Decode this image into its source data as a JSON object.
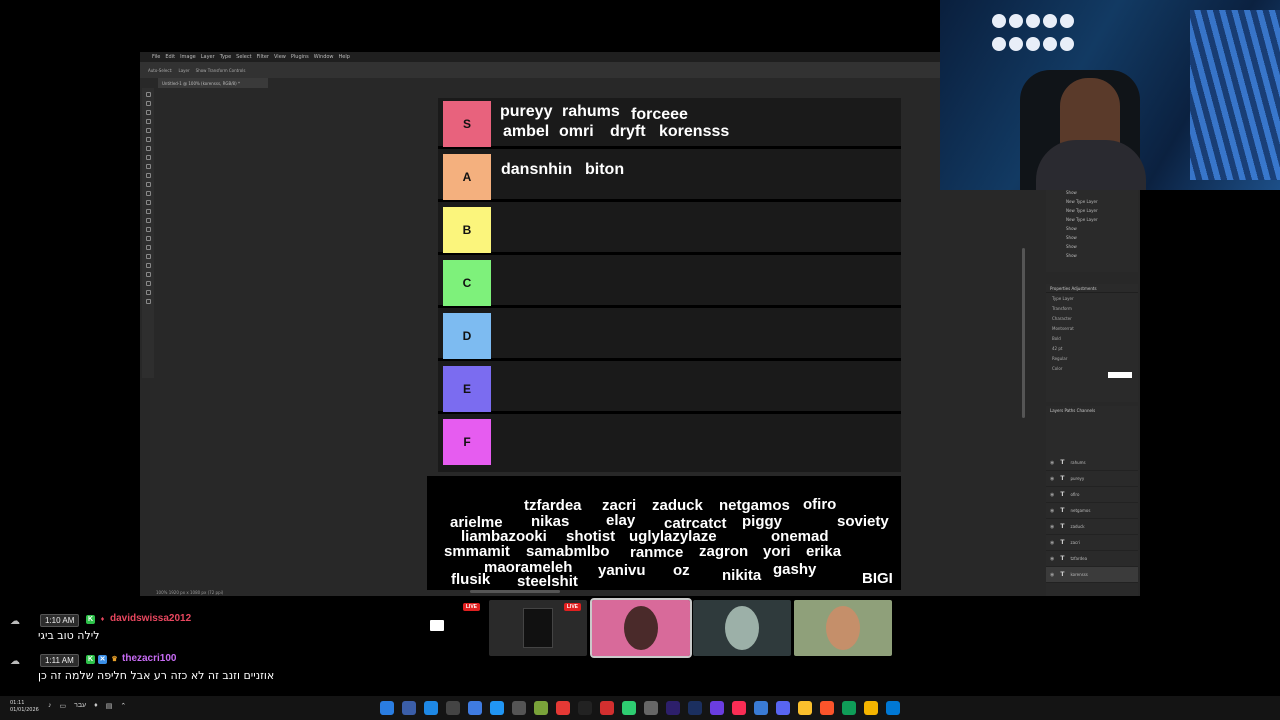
{
  "photoshop": {
    "menu": [
      "File",
      "Edit",
      "Image",
      "Layer",
      "Type",
      "Select",
      "Filter",
      "View",
      "Plugins",
      "Window",
      "Help"
    ],
    "options": [
      "Auto-Select:",
      "Layer",
      "Show Transform Controls"
    ],
    "doc_tab": "Untitled-1 @ 100% (korensss, RGB/8) *",
    "status": "100% 1920 px x 1080 px (72 ppi)"
  },
  "tierlist": {
    "tiers": [
      {
        "label": "S",
        "color": "#e8627d"
      },
      {
        "label": "A",
        "color": "#f4b07e"
      },
      {
        "label": "B",
        "color": "#fbf57c"
      },
      {
        "label": "C",
        "color": "#7ef17b"
      },
      {
        "label": "D",
        "color": "#7dbbf1"
      },
      {
        "label": "E",
        "color": "#7b6cf0"
      },
      {
        "label": "F",
        "color": "#e65cf0"
      }
    ],
    "s_names": [
      "pureyy",
      "rahums",
      "forceee",
      "ambel",
      "omri",
      "dryft",
      "korensss"
    ],
    "a_names": [
      "dansnhin",
      "biton"
    ],
    "pool": [
      "tzfardea",
      "zacri",
      "zaduck",
      "netgamos",
      "ofiro",
      "arielme",
      "nikas",
      "elay",
      "catrcatct",
      "piggy",
      "soviety",
      "liambazooki",
      "shotist",
      "uglylazylaze",
      "onemad",
      "smmamit",
      "samabmlbo",
      "ranmce",
      "zagron",
      "yori",
      "erika",
      "maorameleh",
      "yanivu",
      "oz",
      "nikita",
      "gashy",
      "flusik",
      "steelshit",
      "BIGI"
    ]
  },
  "panels": {
    "layers_top": [
      "Show",
      "New Type Layer",
      "New Type Layer",
      "New Type Layer",
      "Show",
      "Show",
      "Show",
      "Show"
    ],
    "properties_tabs": "Properties   Adjustments",
    "properties": [
      "Type Layer",
      "Transform",
      "Character",
      "Montserrat",
      "Bold",
      "42 pt",
      "Regular",
      "Color"
    ],
    "layers_tabs": "Layers   Paths   Channels",
    "layers": [
      "rahums",
      "pureyy",
      "ofiro",
      "netgamos",
      "zaduck",
      "zacri",
      "tzfardea",
      "korensss"
    ]
  },
  "chat": [
    {
      "time": "1:10 AM",
      "user": "davidswissa2012",
      "user_color": "#e8475f",
      "message": "לילה טוב ביגי"
    },
    {
      "time": "1:11 AM",
      "user": "thezacri100",
      "user_color": "#c86cf5",
      "message": "אוזניים וזנב זה לא כזה רע אבל חליפה שלמה זה כן"
    }
  ],
  "thumbnails": [
    {
      "live": "LIVE"
    },
    {
      "live": "LIVE"
    }
  ],
  "taskbar": {
    "time": "01:11",
    "date": "01/01/2026",
    "lang": "עבר"
  }
}
